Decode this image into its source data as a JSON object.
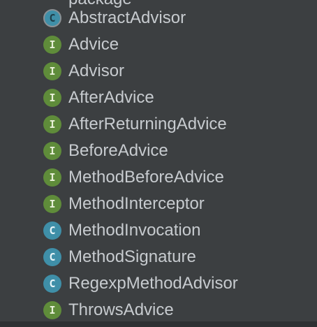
{
  "partial_heading": "package",
  "items": [
    {
      "kind": "abstract",
      "icon_letter": "C",
      "icon_name": "abstract-class-icon",
      "label": "AbstractAdvisor"
    },
    {
      "kind": "interface",
      "icon_letter": "I",
      "icon_name": "interface-icon",
      "label": "Advice"
    },
    {
      "kind": "interface",
      "icon_letter": "I",
      "icon_name": "interface-icon",
      "label": "Advisor"
    },
    {
      "kind": "interface",
      "icon_letter": "I",
      "icon_name": "interface-icon",
      "label": "AfterAdvice"
    },
    {
      "kind": "interface",
      "icon_letter": "I",
      "icon_name": "interface-icon",
      "label": "AfterReturningAdvice"
    },
    {
      "kind": "interface",
      "icon_letter": "I",
      "icon_name": "interface-icon",
      "label": "BeforeAdvice"
    },
    {
      "kind": "interface",
      "icon_letter": "I",
      "icon_name": "interface-icon",
      "label": "MethodBeforeAdvice"
    },
    {
      "kind": "interface",
      "icon_letter": "I",
      "icon_name": "interface-icon",
      "label": "MethodInterceptor"
    },
    {
      "kind": "class",
      "icon_letter": "C",
      "icon_name": "class-icon",
      "label": "MethodInvocation"
    },
    {
      "kind": "class",
      "icon_letter": "C",
      "icon_name": "class-icon",
      "label": "MethodSignature"
    },
    {
      "kind": "class",
      "icon_letter": "C",
      "icon_name": "class-icon",
      "label": "RegexpMethodAdvisor"
    },
    {
      "kind": "interface",
      "icon_letter": "I",
      "icon_name": "interface-icon",
      "label": "ThrowsAdvice"
    }
  ],
  "colors": {
    "background": "#3c3f41",
    "text": "#c7cbcf",
    "interface_icon": "#5f8c3a",
    "class_icon": "#3f8fa8"
  }
}
